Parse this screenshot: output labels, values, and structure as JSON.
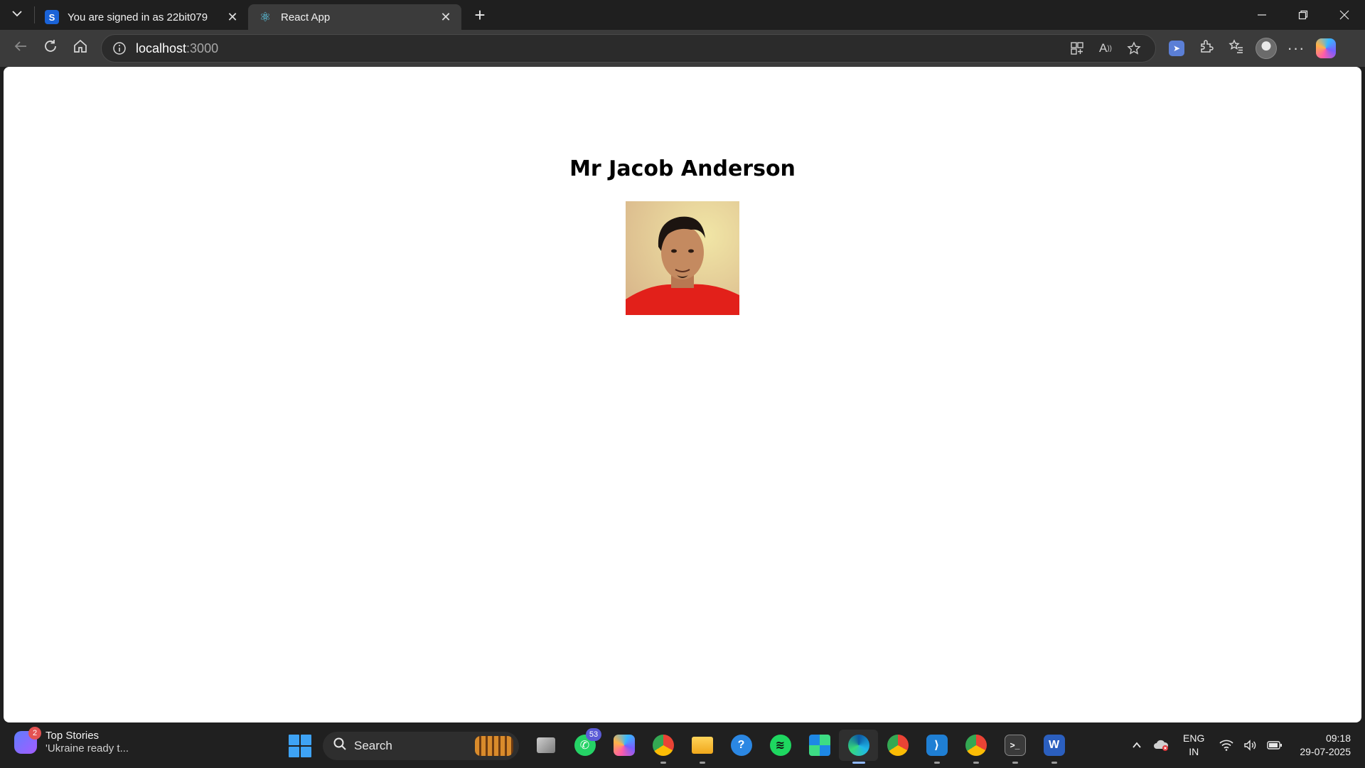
{
  "browser": {
    "tabs": [
      {
        "title": "You are signed in as 22bit079",
        "favicon_letter": "S",
        "favicon_color": "#1a63d8",
        "active": false
      },
      {
        "title": "React App",
        "favicon_letter": "⚛",
        "favicon_color": "#61dafb",
        "active": true
      }
    ],
    "tab_menu_icon": "chevron-down-icon",
    "new_tab_icon": "plus-icon",
    "address": {
      "host": "localhost",
      "port": ":3000"
    }
  },
  "page": {
    "heading": "Mr Jacob Anderson",
    "photo_alt": "profile photo"
  },
  "taskbar": {
    "widget": {
      "badge": "2",
      "title": "Top Stories",
      "subtitle": "'Ukraine ready t..."
    },
    "search_label": "Search",
    "whatsapp_badge": "53",
    "tray": {
      "lang_top": "ENG",
      "lang_bottom": "IN",
      "time": "09:18",
      "date": "29-07-2025"
    }
  },
  "colors": {
    "accent": "#3ea3f5",
    "page_bg": "#ffffff",
    "chrome_bg": "#1f1f1f",
    "toolbar_bg": "#3b3b3b"
  }
}
